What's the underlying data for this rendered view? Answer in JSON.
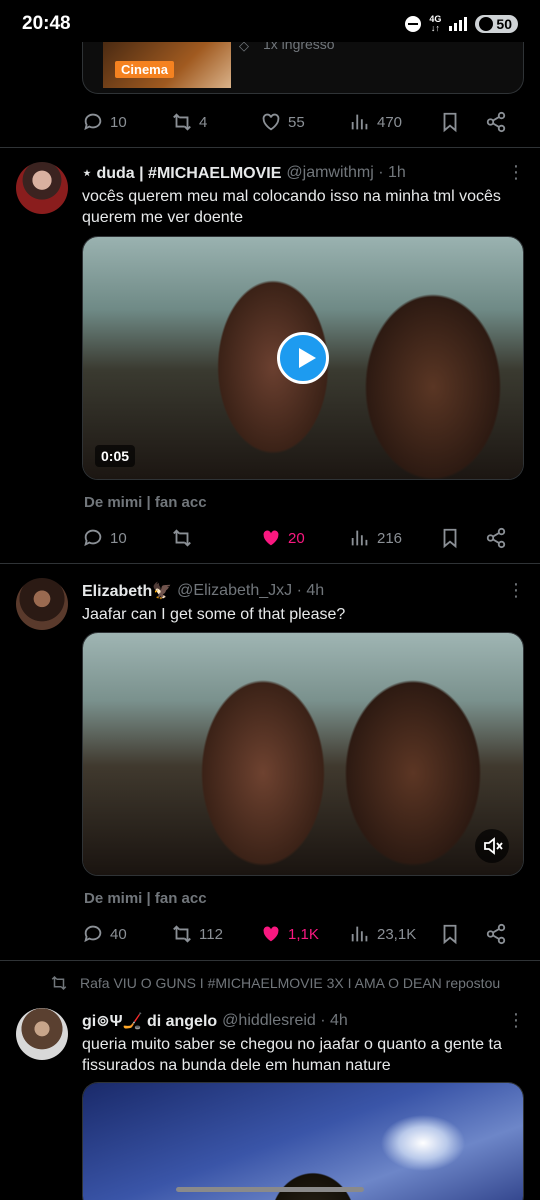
{
  "status_bar": {
    "time": "20:48",
    "network": "4G",
    "battery": "50"
  },
  "tweets": [
    {
      "card_label": "Cinema",
      "card_text": "1x ingresso",
      "actions": {
        "comments": "10",
        "reposts": "4",
        "likes": "55",
        "views": "470"
      }
    },
    {
      "name": "⋆ duda | #MICHAELMOVIE",
      "handle": "@jamwithmj · 1h",
      "text": "vocês querem meu mal colocando isso na minha tml vocês querem me ver doente",
      "video_duration": "0:05",
      "source": "De mimi | fan acc",
      "actions": {
        "comments": "10",
        "reposts": "",
        "likes": "20",
        "views": "216"
      },
      "liked": true
    },
    {
      "name": "Elizabeth🦅",
      "handle": "@Elizabeth_JxJ · 4h",
      "text": "Jaafar can I get some of that please?",
      "source": "De mimi | fan acc",
      "actions": {
        "comments": "40",
        "reposts": "112",
        "likes": "1,1K",
        "views": "23,1K"
      },
      "liked": true
    },
    {
      "repost_by": "Rafa VIU O GUNS I #MICHAELMOVIE 3X I AMA O DEAN repostou",
      "name": "gi⊚Ψ🏒 di angelo",
      "handle": "@hiddlesreid · 4h",
      "text": "queria muito saber se chegou no jaafar o quanto a gente ta fissurados na bunda dele em human nature"
    }
  ],
  "colors": {
    "background": "#000000",
    "text": "#e7e9ea",
    "muted": "#71767b",
    "like": "#f91880",
    "accent": "#1d9bf0",
    "card_orange": "#f58220"
  }
}
